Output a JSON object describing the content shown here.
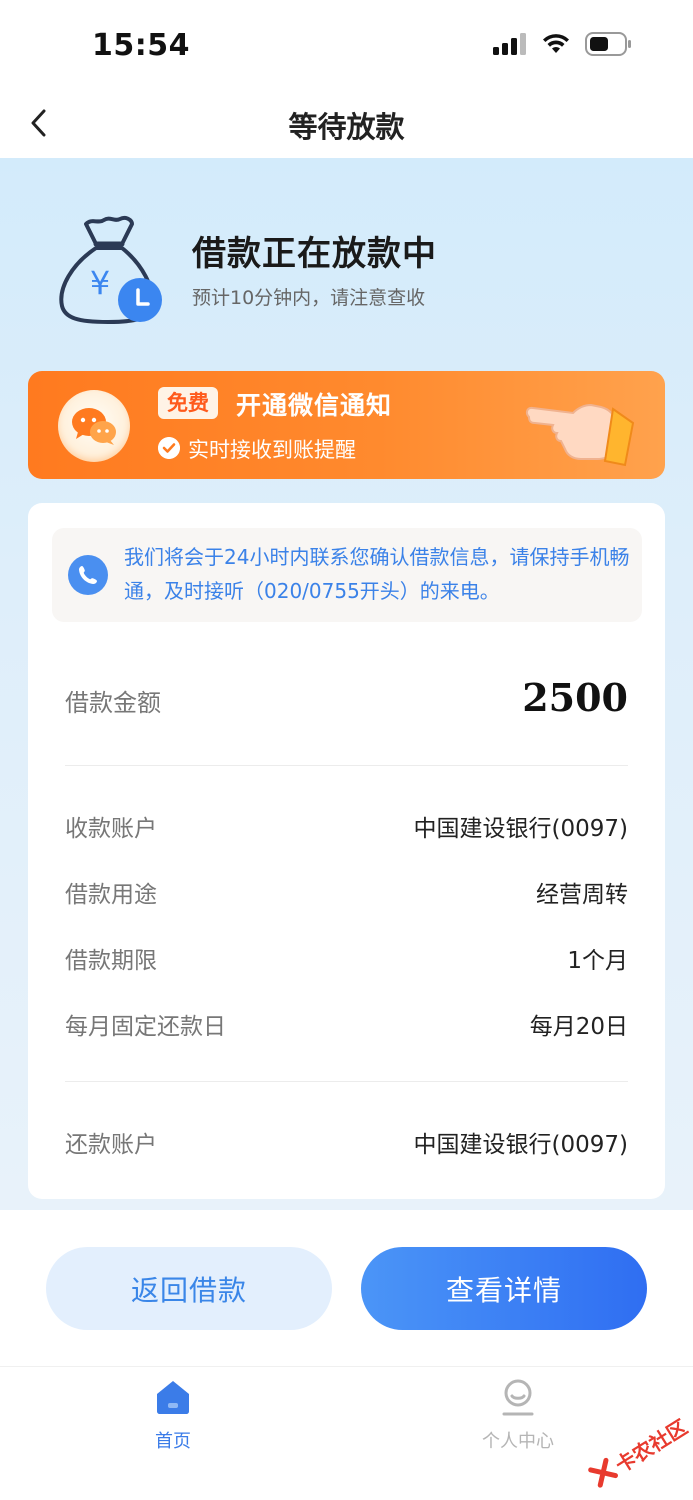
{
  "status_bar": {
    "time": "15:54"
  },
  "nav": {
    "title": "等待放款"
  },
  "hero": {
    "title": "借款正在放款中",
    "subtitle": "预计10分钟内，请注意查收"
  },
  "banner": {
    "tag": "免费",
    "title": "开通微信通知",
    "subtitle": "实时接收到账提醒"
  },
  "notice": {
    "text": "我们将会于24小时内联系您确认借款信息，请保持手机畅通，及时接听（020/0755开头）的来电。"
  },
  "loan": {
    "amount_label": "借款金额",
    "amount_value": "2500",
    "rows": [
      {
        "label": "收款账户",
        "value": "中国建设银行(0097)"
      },
      {
        "label": "借款用途",
        "value": "经营周转"
      },
      {
        "label": "借款期限",
        "value": "1个月"
      },
      {
        "label": "每月固定还款日",
        "value": "每月20日"
      }
    ],
    "repay_label": "还款账户",
    "repay_value": "中国建设银行(0097)"
  },
  "buttons": {
    "back_label": "返回借款",
    "detail_label": "查看详情"
  },
  "tabbar": {
    "home_label": "首页",
    "me_label": "个人中心"
  },
  "watermark": {
    "text": "卡农社区"
  },
  "colors": {
    "accent": "#3b7ce8",
    "banner": "#ff7a1f",
    "hero_bg": "#d3ebfb"
  }
}
